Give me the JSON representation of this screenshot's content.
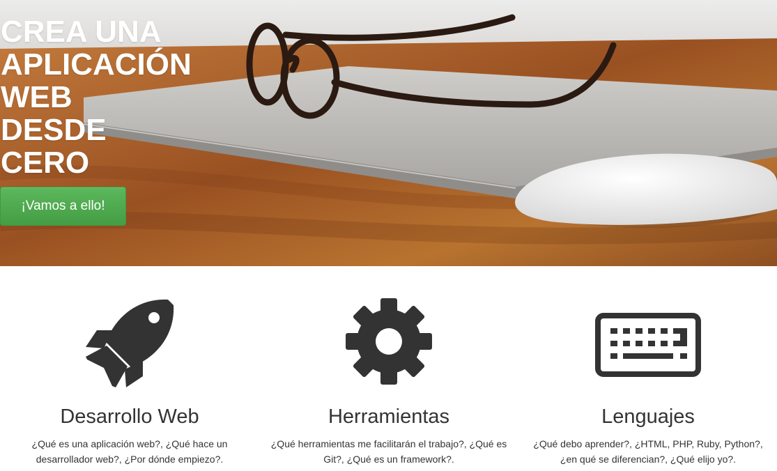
{
  "hero": {
    "title_lines": [
      "CREA UNA",
      "APLICACIÓN",
      "WEB",
      "DESDE",
      "CERO"
    ],
    "cta_label": "¡Vamos a ello!",
    "cta_color": "#5cb85c"
  },
  "features": [
    {
      "icon": "rocket-icon",
      "title": "Desarrollo Web",
      "line1": "¿Qué es una aplicación web?, ¿Qué hace un",
      "line2": "desarrollador web?, ¿Por dónde empiezo?."
    },
    {
      "icon": "gear-icon",
      "title": "Herramientas",
      "line1": "¿Qué herramientas me facilitarán el trabajo?, ¿Qué es",
      "line2": "Git?, ¿Qué es un framework?."
    },
    {
      "icon": "keyboard-icon",
      "title": "Lenguajes",
      "line1": "¿Qué debo aprender?, ¿HTML, PHP, Ruby, Python?,",
      "line2": "¿en qué se diferencian?, ¿Qué elijo yo?."
    }
  ],
  "colors": {
    "icon": "#333333",
    "text": "#333333"
  }
}
